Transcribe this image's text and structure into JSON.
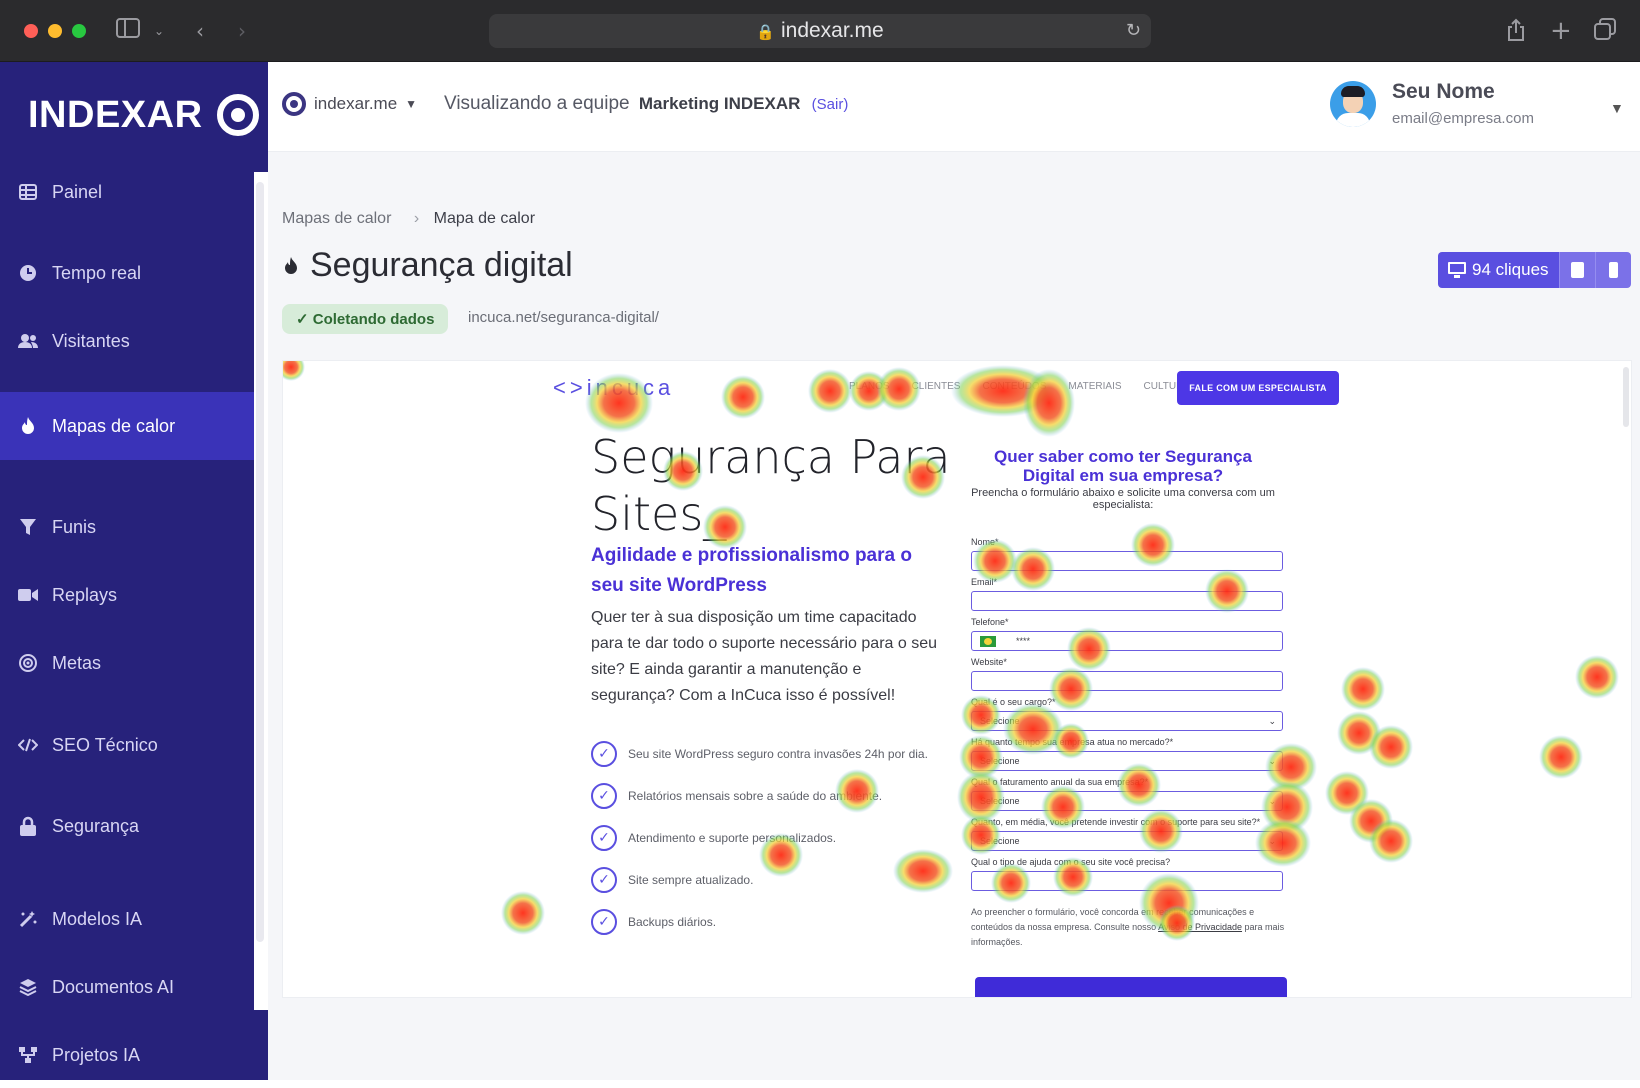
{
  "browser": {
    "url": "indexar.me"
  },
  "sidebar": {
    "brand": "INDEXAR",
    "items": [
      {
        "label": "Painel",
        "icon": "grid-icon"
      },
      {
        "label": "Tempo real",
        "icon": "clock-icon"
      },
      {
        "label": "Visitantes",
        "icon": "users-icon"
      },
      {
        "label": "Mapas de calor",
        "icon": "fire-icon",
        "active": true
      },
      {
        "label": "Funis",
        "icon": "funnel-icon"
      },
      {
        "label": "Replays",
        "icon": "video-icon"
      },
      {
        "label": "Metas",
        "icon": "target-icon"
      },
      {
        "label": "SEO Técnico",
        "icon": "code-icon"
      },
      {
        "label": "Segurança",
        "icon": "lock-icon"
      },
      {
        "label": "Modelos IA",
        "icon": "magic-wand-icon"
      },
      {
        "label": "Documentos AI",
        "icon": "layers-icon"
      },
      {
        "label": "Projetos IA",
        "icon": "sitemap-icon"
      }
    ]
  },
  "topbar": {
    "site_selector": "indexar.me",
    "team_prefix": "Visualizando a equipe",
    "team_name": "Marketing INDEXAR",
    "logout": "(Sair)",
    "user_name": "Seu Nome",
    "user_email": "email@empresa.com"
  },
  "breadcrumb": {
    "parent": "Mapas de calor",
    "current": "Mapa de calor"
  },
  "page": {
    "title": "Segurança digital",
    "status": "Coletando dados",
    "url": "incuca.net/seguranca-digital/",
    "clicks": "94 cliques"
  },
  "preview": {
    "logo": "incuca",
    "nav": [
      "PLANOS",
      "CLIENTES",
      "CONTEÚDOS",
      "MATERIAIS",
      "CULTURA"
    ],
    "cta": "FALE COM UM ESPECIALISTA",
    "hero_title": "Segurança Para Sites_",
    "hero_subtitle": "Agilidade e profissionalismo para o seu site WordPress",
    "hero_body": "Quer ter à sua disposição um time capacitado para te dar todo o suporte necessário para o seu site? E ainda garantir a manutenção e segurança? Com a InCuca isso é possível!",
    "checklist": [
      "Seu site WordPress seguro contra invasões 24h por dia.",
      "Relatórios mensais sobre a saúde do ambiente.",
      "Atendimento e suporte personalizados.",
      "Site sempre atualizado.",
      "Backups diários."
    ],
    "form_title": "Quer saber como ter Segurança Digital em sua empresa?",
    "form_intro": "Preencha o formulário abaixo e solicite uma conversa com um especialista:",
    "fields": {
      "nome": "Nome*",
      "email": "Email*",
      "telefone": "Telefone*",
      "telefone_value": "****",
      "website": "Website*",
      "cargo": "Qual é o seu cargo?*",
      "tempo": "Há quanto tempo sua empresa atua no mercado?*",
      "faturamento": "Qual o faturamento anual da sua empresa?*",
      "investimento": "Quanto, em média, você pretende investir com o suporte para seu site?*",
      "ajuda": "Qual o tipo de ajuda com o seu site você precisa?",
      "select_placeholder": "Selecione"
    },
    "legal_prefix": "Ao preencher o formulário, você concorda em receber comunicações e conteúdos da nossa empresa. Consulte nosso",
    "legal_link": "Aviso de Privacidade",
    "legal_suffix": "para mais informações."
  },
  "colors": {
    "sidebar_bg": "#27227b",
    "sidebar_active": "#3a33b8",
    "accent": "#5a4fe0",
    "status_bg": "#d7ecd9"
  }
}
